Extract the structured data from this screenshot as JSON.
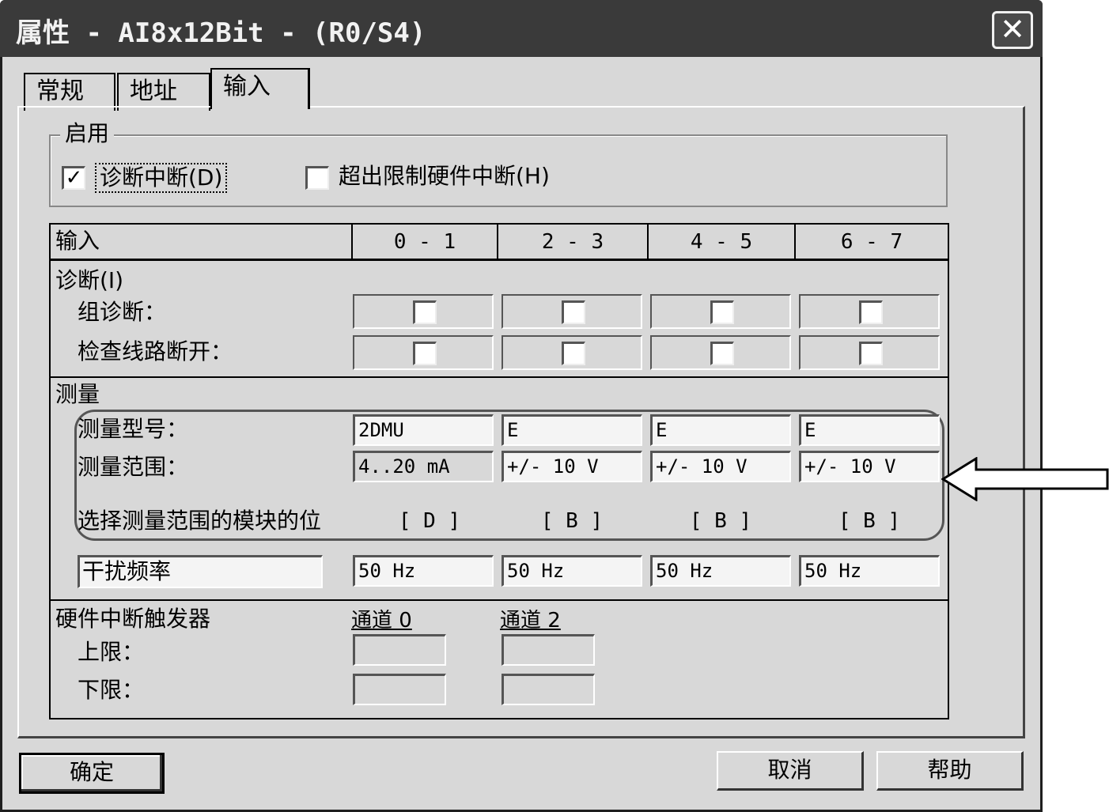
{
  "window": {
    "title": "属性 - AI8x12Bit - (R0/S4)",
    "close_label": "✕"
  },
  "tabs": [
    {
      "label": "常规",
      "active": false
    },
    {
      "label": "地址",
      "active": false
    },
    {
      "label": "输入",
      "active": true
    }
  ],
  "enable_group": {
    "legend": "启用",
    "diag_interrupt": {
      "label": "诊断中断(D)",
      "checked": true
    },
    "hw_interrupt": {
      "label": "超出限制硬件中断(H)",
      "checked": false
    }
  },
  "table": {
    "header": [
      "输入",
      "0 - 1",
      "2 - 3",
      "4 - 5",
      "6 - 7"
    ],
    "diag_section": "诊断(I)",
    "group_diag_label": "组诊断：",
    "wire_break_label": "检查线路断开：",
    "measure_section": "测量",
    "measure_type_label": "测量型号：",
    "measure_range_label": "测量范围：",
    "module_pos_label": "选择测量范围的模块的位",
    "measure_types": [
      "2DMU",
      "E",
      "E",
      "E"
    ],
    "measure_ranges": [
      "4..20 mA",
      "+/- 10 V",
      "+/- 10 V",
      "+/- 10 V"
    ],
    "module_positions": [
      "[ D ]",
      "[ B ]",
      "[ B ]",
      "[ B ]"
    ],
    "interference_label": "干扰频率",
    "interference_values": [
      "50 Hz",
      "50 Hz",
      "50 Hz",
      "50 Hz"
    ],
    "hw_trigger_section": "硬件中断触发器",
    "channel0_label": "通道 0",
    "channel2_label": "通道 2",
    "upper_limit_label": "上限：",
    "lower_limit_label": "下限："
  },
  "buttons": {
    "ok": "确定",
    "cancel": "取消",
    "help": "帮助"
  }
}
